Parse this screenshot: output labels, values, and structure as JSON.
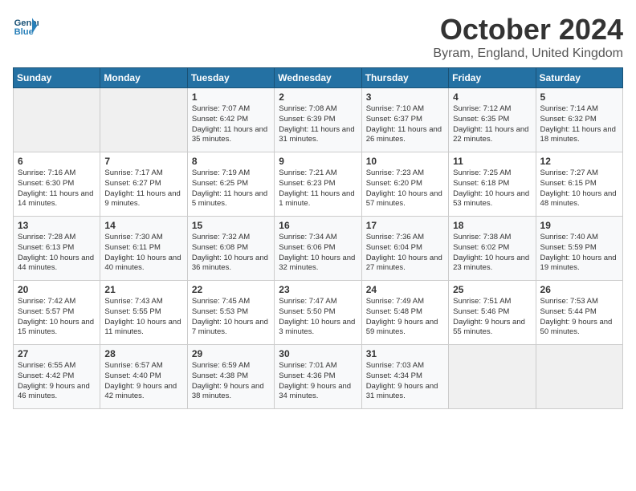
{
  "header": {
    "logo_general": "General",
    "logo_blue": "Blue",
    "month_title": "October 2024",
    "location": "Byram, England, United Kingdom"
  },
  "days_of_week": [
    "Sunday",
    "Monday",
    "Tuesday",
    "Wednesday",
    "Thursday",
    "Friday",
    "Saturday"
  ],
  "weeks": [
    [
      {
        "day": "",
        "content": ""
      },
      {
        "day": "",
        "content": ""
      },
      {
        "day": "1",
        "content": "Sunrise: 7:07 AM\nSunset: 6:42 PM\nDaylight: 11 hours and 35 minutes."
      },
      {
        "day": "2",
        "content": "Sunrise: 7:08 AM\nSunset: 6:39 PM\nDaylight: 11 hours and 31 minutes."
      },
      {
        "day": "3",
        "content": "Sunrise: 7:10 AM\nSunset: 6:37 PM\nDaylight: 11 hours and 26 minutes."
      },
      {
        "day": "4",
        "content": "Sunrise: 7:12 AM\nSunset: 6:35 PM\nDaylight: 11 hours and 22 minutes."
      },
      {
        "day": "5",
        "content": "Sunrise: 7:14 AM\nSunset: 6:32 PM\nDaylight: 11 hours and 18 minutes."
      }
    ],
    [
      {
        "day": "6",
        "content": "Sunrise: 7:16 AM\nSunset: 6:30 PM\nDaylight: 11 hours and 14 minutes."
      },
      {
        "day": "7",
        "content": "Sunrise: 7:17 AM\nSunset: 6:27 PM\nDaylight: 11 hours and 9 minutes."
      },
      {
        "day": "8",
        "content": "Sunrise: 7:19 AM\nSunset: 6:25 PM\nDaylight: 11 hours and 5 minutes."
      },
      {
        "day": "9",
        "content": "Sunrise: 7:21 AM\nSunset: 6:23 PM\nDaylight: 11 hours and 1 minute."
      },
      {
        "day": "10",
        "content": "Sunrise: 7:23 AM\nSunset: 6:20 PM\nDaylight: 10 hours and 57 minutes."
      },
      {
        "day": "11",
        "content": "Sunrise: 7:25 AM\nSunset: 6:18 PM\nDaylight: 10 hours and 53 minutes."
      },
      {
        "day": "12",
        "content": "Sunrise: 7:27 AM\nSunset: 6:15 PM\nDaylight: 10 hours and 48 minutes."
      }
    ],
    [
      {
        "day": "13",
        "content": "Sunrise: 7:28 AM\nSunset: 6:13 PM\nDaylight: 10 hours and 44 minutes."
      },
      {
        "day": "14",
        "content": "Sunrise: 7:30 AM\nSunset: 6:11 PM\nDaylight: 10 hours and 40 minutes."
      },
      {
        "day": "15",
        "content": "Sunrise: 7:32 AM\nSunset: 6:08 PM\nDaylight: 10 hours and 36 minutes."
      },
      {
        "day": "16",
        "content": "Sunrise: 7:34 AM\nSunset: 6:06 PM\nDaylight: 10 hours and 32 minutes."
      },
      {
        "day": "17",
        "content": "Sunrise: 7:36 AM\nSunset: 6:04 PM\nDaylight: 10 hours and 27 minutes."
      },
      {
        "day": "18",
        "content": "Sunrise: 7:38 AM\nSunset: 6:02 PM\nDaylight: 10 hours and 23 minutes."
      },
      {
        "day": "19",
        "content": "Sunrise: 7:40 AM\nSunset: 5:59 PM\nDaylight: 10 hours and 19 minutes."
      }
    ],
    [
      {
        "day": "20",
        "content": "Sunrise: 7:42 AM\nSunset: 5:57 PM\nDaylight: 10 hours and 15 minutes."
      },
      {
        "day": "21",
        "content": "Sunrise: 7:43 AM\nSunset: 5:55 PM\nDaylight: 10 hours and 11 minutes."
      },
      {
        "day": "22",
        "content": "Sunrise: 7:45 AM\nSunset: 5:53 PM\nDaylight: 10 hours and 7 minutes."
      },
      {
        "day": "23",
        "content": "Sunrise: 7:47 AM\nSunset: 5:50 PM\nDaylight: 10 hours and 3 minutes."
      },
      {
        "day": "24",
        "content": "Sunrise: 7:49 AM\nSunset: 5:48 PM\nDaylight: 9 hours and 59 minutes."
      },
      {
        "day": "25",
        "content": "Sunrise: 7:51 AM\nSunset: 5:46 PM\nDaylight: 9 hours and 55 minutes."
      },
      {
        "day": "26",
        "content": "Sunrise: 7:53 AM\nSunset: 5:44 PM\nDaylight: 9 hours and 50 minutes."
      }
    ],
    [
      {
        "day": "27",
        "content": "Sunrise: 6:55 AM\nSunset: 4:42 PM\nDaylight: 9 hours and 46 minutes."
      },
      {
        "day": "28",
        "content": "Sunrise: 6:57 AM\nSunset: 4:40 PM\nDaylight: 9 hours and 42 minutes."
      },
      {
        "day": "29",
        "content": "Sunrise: 6:59 AM\nSunset: 4:38 PM\nDaylight: 9 hours and 38 minutes."
      },
      {
        "day": "30",
        "content": "Sunrise: 7:01 AM\nSunset: 4:36 PM\nDaylight: 9 hours and 34 minutes."
      },
      {
        "day": "31",
        "content": "Sunrise: 7:03 AM\nSunset: 4:34 PM\nDaylight: 9 hours and 31 minutes."
      },
      {
        "day": "",
        "content": ""
      },
      {
        "day": "",
        "content": ""
      }
    ]
  ]
}
